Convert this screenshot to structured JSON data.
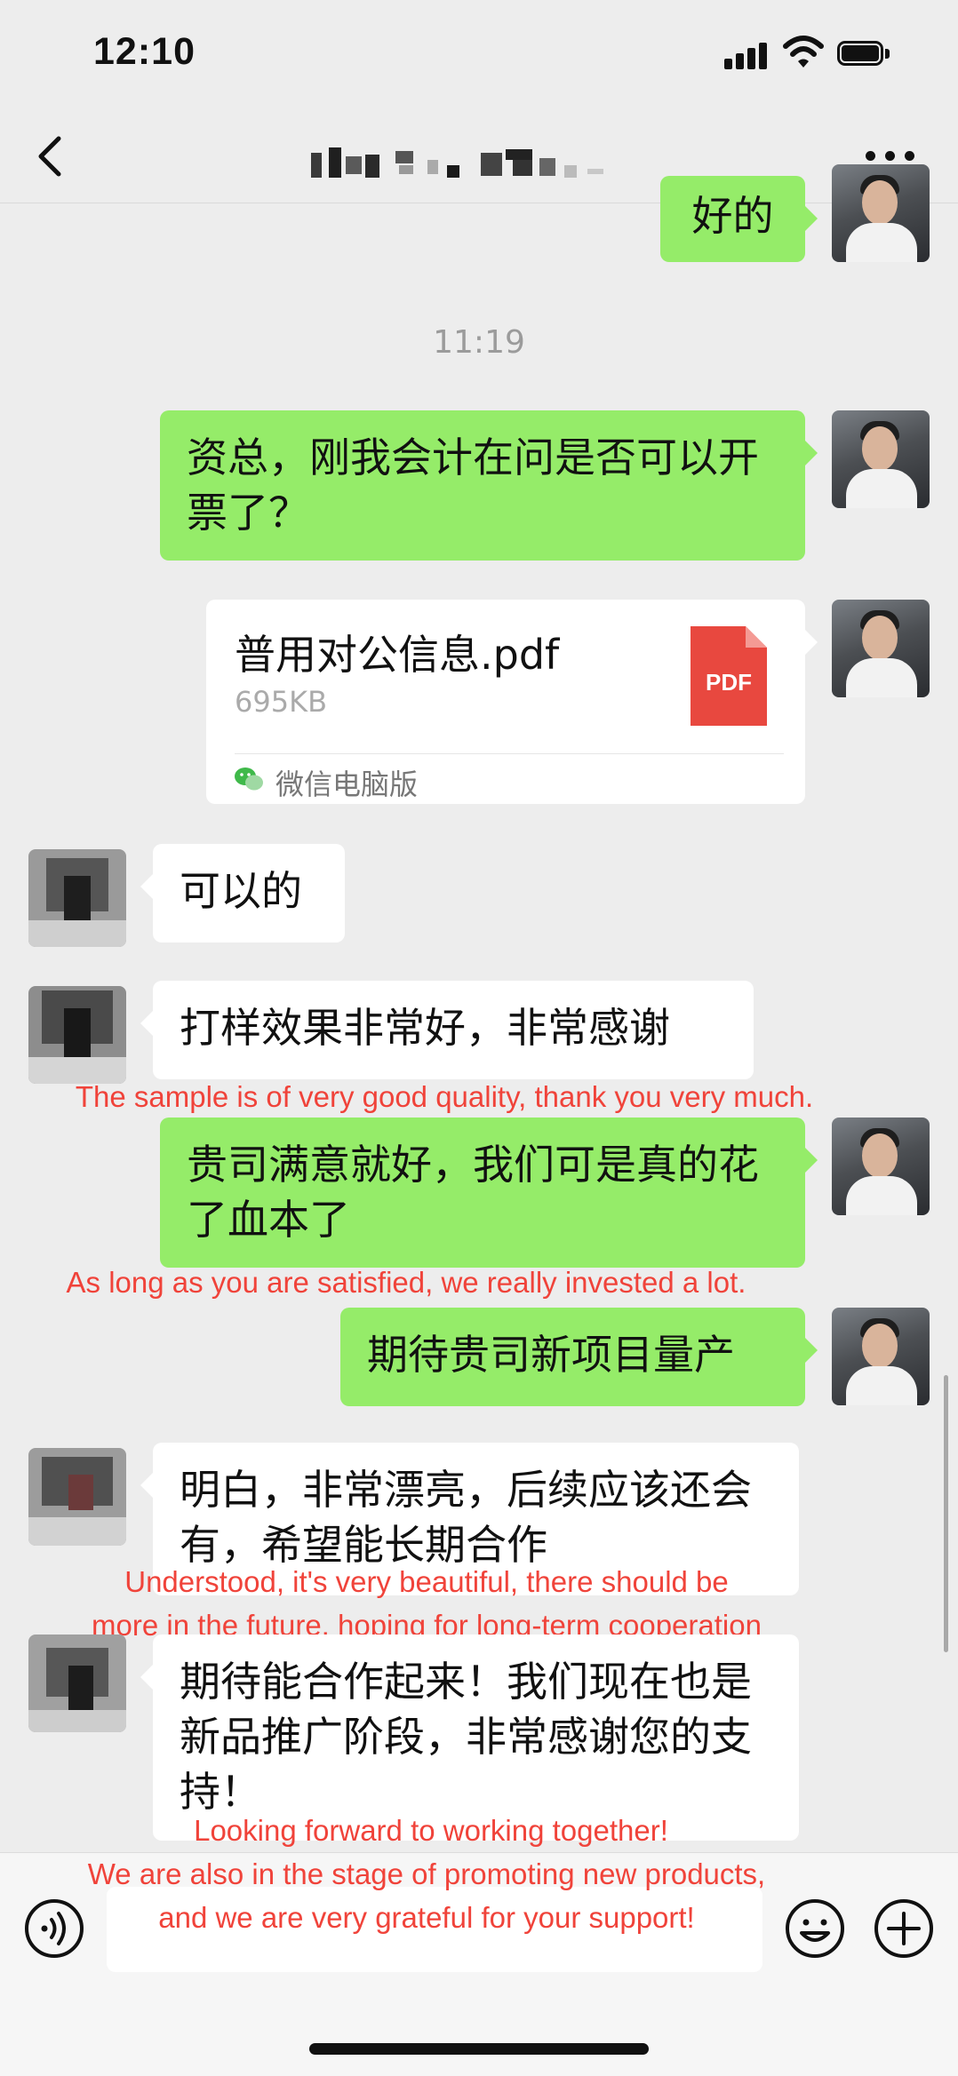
{
  "status_bar": {
    "time": "12:10"
  },
  "nav": {
    "title": ""
  },
  "timestamp": "11:19",
  "messages": {
    "m0": {
      "text": "好的"
    },
    "m1": {
      "text": "资总，刚我会计在问是否可以开票了？"
    },
    "m3": {
      "text": "可以的"
    },
    "m4": {
      "text": "打样效果非常好，非常感谢",
      "translation": "The sample is of very good quality, thank you very much."
    },
    "m5": {
      "text": "贵司满意就好，我们可是真的花了血本了",
      "translation": "As long as you are satisfied, we really invested a lot."
    },
    "m6": {
      "text": "期待贵司新项目量产"
    },
    "m7": {
      "text": "明白，非常漂亮，后续应该还会有，希望能长期合作",
      "translation_line1": "Understood, it's very beautiful, there should be",
      "translation_line2": "more in the future, hoping for long-term cooperation"
    },
    "m8": {
      "text": "期待能合作起来！我们现在也是新品推广阶段，非常感谢您的支持！",
      "translation_line1": "Looking forward to working together!",
      "translation_line2": "We are also in the stage of promoting new products,",
      "translation_line3": "and we are very grateful for your support!"
    }
  },
  "file": {
    "name": "普用对公信息.pdf",
    "size": "695KB",
    "icon_label": "PDF",
    "source": "微信电脑版"
  },
  "colors": {
    "my_bubble": "#95ec69",
    "other_bubble": "#ffffff",
    "background": "#ededed",
    "translation_text": "#f0433a",
    "pdf_icon": "#e8483f"
  },
  "icons": [
    "back-icon",
    "more-icon",
    "pdf-icon",
    "wechat-icon",
    "voice-icon",
    "emoji-icon",
    "plus-icon"
  ]
}
